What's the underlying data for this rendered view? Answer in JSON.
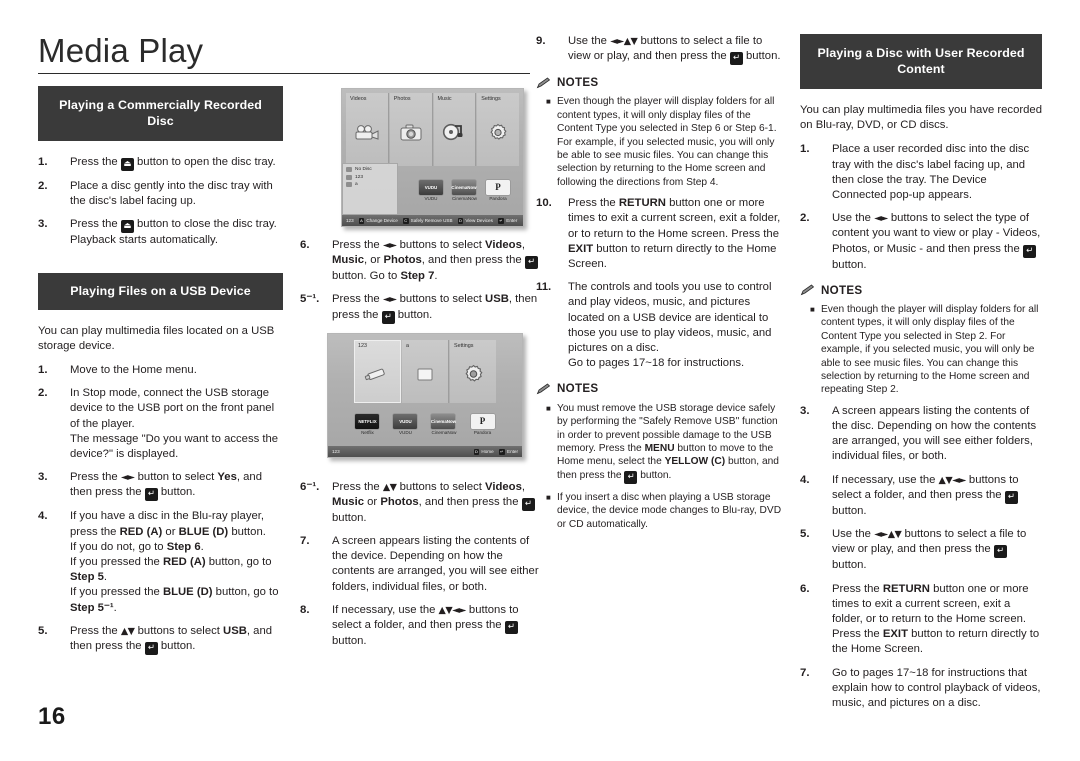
{
  "page": {
    "title": "Media Play",
    "number": "16"
  },
  "col1": {
    "section1": {
      "heading": "Playing a Commercially Recorded Disc",
      "steps": [
        {
          "num": "1.",
          "html": "Press the <span class=\"key\" data-name=\"eject-key-icon\">⏏</span> button to open the disc tray."
        },
        {
          "num": "2.",
          "html": "Place a disc gently into the disc tray with the disc's label facing up."
        },
        {
          "num": "3.",
          "html": "Press the <span class=\"key\" data-name=\"eject-key-icon\">⏏</span> button to close the disc tray. Playback starts automatically."
        }
      ]
    },
    "section2": {
      "heading": "Playing Files on a USB Device",
      "intro": "You can play multimedia files located on a USB storage device.",
      "steps": [
        {
          "num": "1.",
          "html": "Move to the Home menu."
        },
        {
          "num": "2.",
          "html": "In Stop mode, connect the USB storage device to the USB port on the front panel of the player.<br>The message \"Do you want to access the device?\" is displayed."
        },
        {
          "num": "3.",
          "html": "Press the <span class=\"arrows\">◄►</span> button to select <b>Yes</b>, and then press the <span class=\"key key-enter\" data-name=\"enter-key-icon\">↵</span> button."
        },
        {
          "num": "4.",
          "html": "If you have a disc in the Blu-ray player, press the <b>RED (A)</b> or <b>BLUE (D)</b> button.<br>If you do not, go to <b>Step 6</b>.<br>If you pressed the <b>RED (A)</b> button, go to <b>Step 5</b>.<br>If you pressed the <b>BLUE (D)</b> button, go to <b>Step 5⁻¹</b>."
        },
        {
          "num": "5.",
          "html": "Press the <span class=\"arrows\">▲▼</span> buttons to select <b>USB</b>, and then press the <span class=\"key key-enter\" data-name=\"enter-key-icon\">↵</span> button."
        }
      ]
    }
  },
  "col2": {
    "steps_top": [
      {
        "num": "6.",
        "html": "Press the <span class=\"arrows\">◄►</span> buttons to select <b>Videos</b>, <b>Music</b>, or <b>Photos</b>, and then press the <span class=\"key key-enter\" data-name=\"enter-key-icon\">↵</span> button. Go to <b>Step 7</b>."
      },
      {
        "num": "5⁻¹.",
        "html": "Press the <span class=\"arrows\">◄►</span> buttons to select <b>USB</b>, then press the <span class=\"key key-enter\" data-name=\"enter-key-icon\">↵</span> button."
      }
    ],
    "steps_bottom": [
      {
        "num": "6⁻¹.",
        "html": "Press the <span class=\"arrows\">▲▼</span> buttons to select <b>Videos</b>, <b>Music</b> or <b>Photos</b>, and then press the <span class=\"key key-enter\" data-name=\"enter-key-icon\">↵</span> button."
      },
      {
        "num": "7.",
        "html": "A screen appears listing the contents of the device. Depending on how the contents are arranged, you will see either folders, individual files, or both."
      },
      {
        "num": "8.",
        "html": "If necessary, use the <span class=\"arrows\">▲▼◄►</span> buttons to select a folder, and then press the <span class=\"key key-enter\" data-name=\"enter-key-icon\">↵</span> button."
      }
    ]
  },
  "col3": {
    "steps_top": [
      {
        "num": "9.",
        "html": "Use the <span class=\"arrows\">◄►▲▼</span> buttons to select a file to view or play, and then press the <span class=\"key key-enter\" data-name=\"enter-key-icon\">↵</span> button."
      }
    ],
    "notes1": {
      "label": "NOTES",
      "items": [
        "Even though the player will display folders for all content types, it will only display files of the Content Type you selected in Step 6 or Step 6-1.<br>For example, if you selected music, you will only be able to see music files. You can change this selection by returning to the Home screen and following the directions from Step 4."
      ]
    },
    "steps_bottom": [
      {
        "num": "10.",
        "html": "Press the <b>RETURN</b> button one or more times to exit a current screen, exit a folder, or to return to the Home screen. Press the <b>EXIT</b> button to return directly to the Home Screen."
      },
      {
        "num": "11.",
        "html": "The controls and tools you use to control and play videos, music, and pictures located on a USB device are identical to those you use to play videos, music, and pictures on a disc.<br>Go to pages 17~18 for instructions."
      }
    ],
    "notes2": {
      "label": "NOTES",
      "items": [
        "You must remove the USB storage device safely by performing the \"Safely Remove USB\" function in order to prevent possible damage to the USB memory. Press the <b>MENU</b> button to move to the Home menu, select the <b>YELLOW (C)</b> button, and then press the <span class=\"key key-enter\" data-name=\"enter-key-icon\">↵</span> button.",
        "If you insert a disc when playing a USB storage device, the device mode changes to Blu-ray, DVD or CD automatically."
      ]
    }
  },
  "col4": {
    "heading": "Playing a Disc with User Recorded Content",
    "intro": "You can play multimedia files you have recorded on Blu-ray, DVD, or CD discs.",
    "steps_top": [
      {
        "num": "1.",
        "html": "Place a user recorded disc into the disc tray with the disc's label facing up, and then close the tray. The Device Connected pop-up appears."
      },
      {
        "num": "2.",
        "html": "Use the <span class=\"arrows\">◄►</span> buttons to select the type of content you want to view or play - Videos, Photos, or Music - and then press the <span class=\"key key-enter\" data-name=\"enter-key-icon\">↵</span> button."
      }
    ],
    "notes": {
      "label": "NOTES",
      "items": [
        "Even though the player will display folders for all content types, it will only display files of the Content Type you selected in Step 2. For example, if you selected music, you will only be able to see music files. You can change this selection by returning to the Home screen and repeating Step 2."
      ]
    },
    "steps_bottom": [
      {
        "num": "3.",
        "html": "A screen appears listing the contents of the disc. Depending on how the contents are arranged, you will see either folders, individual files, or both."
      },
      {
        "num": "4.",
        "html": "If necessary, use the <span class=\"arrows\">▲▼◄►</span> buttons to select a folder, and then press the <span class=\"key key-enter\" data-name=\"enter-key-icon\">↵</span> button."
      },
      {
        "num": "5.",
        "html": "Use the <span class=\"arrows\">◄►▲▼</span> buttons to select a file to view or play, and then press the <span class=\"key key-enter\" data-name=\"enter-key-icon\">↵</span> button."
      },
      {
        "num": "6.",
        "html": "Press the <b>RETURN</b> button one or more times to exit a current screen, exit a folder, or to return to the Home screen. Press the <b>EXIT</b> button to return directly to the Home Screen."
      },
      {
        "num": "7.",
        "html": "Go to pages 17~18 for instructions that explain how to control playback of videos, music, and pictures on a disc."
      }
    ]
  },
  "screenshot_home": {
    "tiles": [
      {
        "label": "Videos",
        "icon": "camcorder-icon"
      },
      {
        "label": "Photos",
        "icon": "camera-icon"
      },
      {
        "label": "Music",
        "icon": "music-note-icon"
      },
      {
        "label": "Settings",
        "icon": "gear-icon"
      }
    ],
    "devices": [
      {
        "label": "No Disc",
        "icon": "disc-icon"
      },
      {
        "label": "123",
        "icon": "disc-icon"
      },
      {
        "label": "a",
        "icon": "folder-icon"
      }
    ],
    "apps": [
      {
        "name": "VUDU",
        "thumb": "VUDU"
      },
      {
        "name": "CinemaNow",
        "thumb": "CinemaNow"
      },
      {
        "name": "Pandora",
        "thumb": "P"
      }
    ],
    "bar_left": "123",
    "bar_items": [
      {
        "key": "A",
        "label": "Change Device"
      },
      {
        "key": "C",
        "label": "Safely Remove USB"
      },
      {
        "key": "D",
        "label": "View Devices"
      },
      {
        "key": "↵",
        "label": "Enter"
      }
    ]
  },
  "screenshot_usb": {
    "tiles": [
      {
        "label": "123",
        "icon": "usb-stick-icon"
      },
      {
        "label": "a",
        "icon": "folder-icon"
      },
      {
        "label": "Settings",
        "icon": "gear-icon"
      }
    ],
    "apps": [
      {
        "name": "Netflix",
        "thumb": "NETFLIX"
      },
      {
        "name": "VUDU",
        "thumb": "VUDU"
      },
      {
        "name": "CinemaNow",
        "thumb": "CinemaNow"
      },
      {
        "name": "Pandora",
        "thumb": "P"
      }
    ],
    "bar_left": "123",
    "bar_items": [
      {
        "key": "D",
        "label": "Home"
      },
      {
        "key": "↵",
        "label": "Enter"
      }
    ]
  }
}
